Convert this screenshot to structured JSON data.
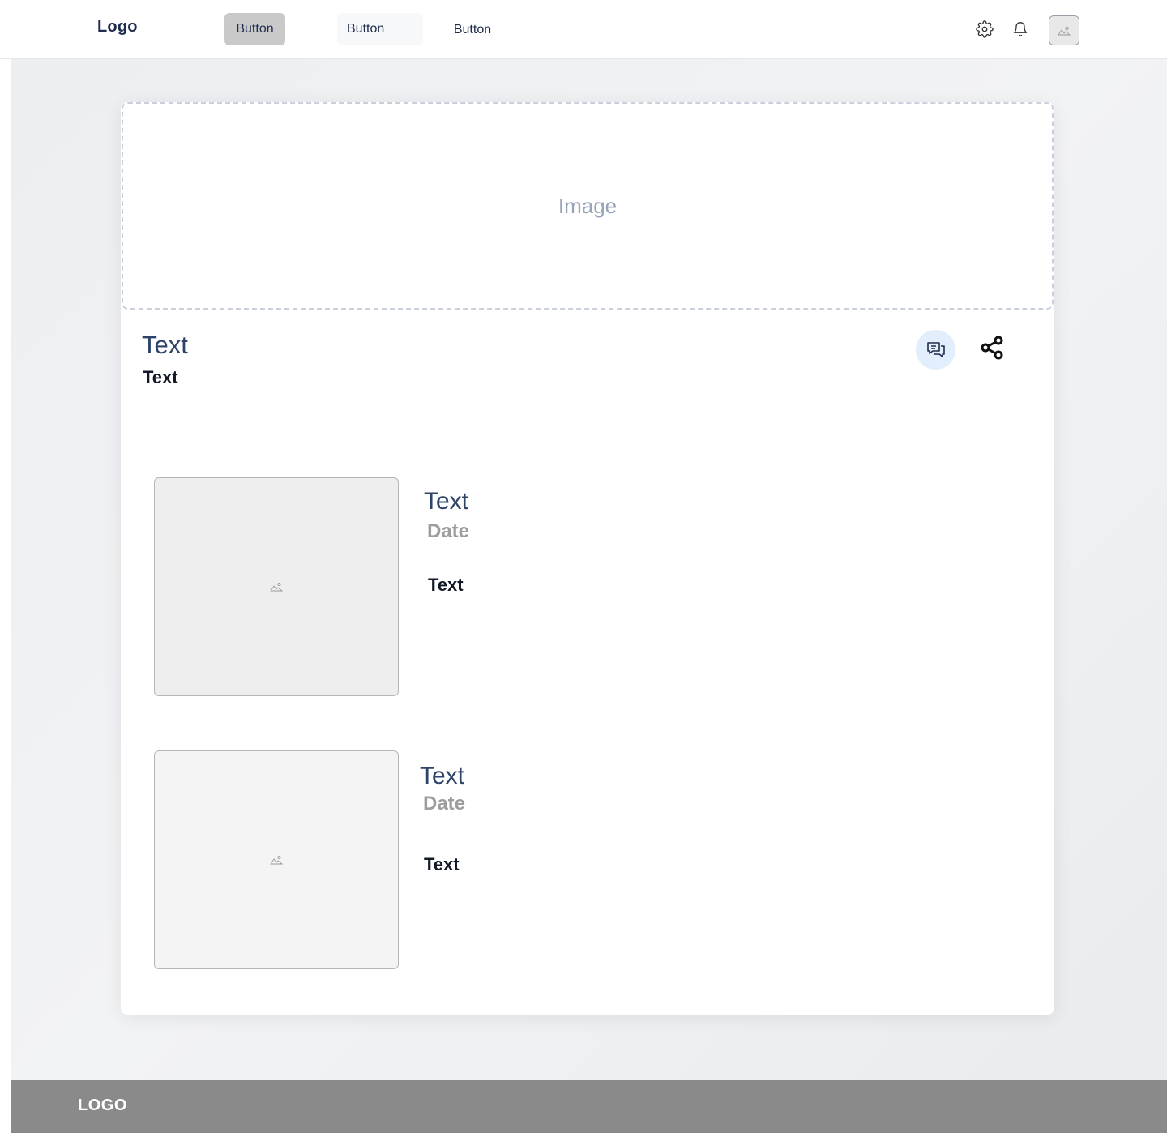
{
  "header": {
    "logo": "Logo",
    "nav": [
      {
        "label": "Button"
      },
      {
        "label": "Button"
      },
      {
        "label": "Button"
      }
    ],
    "icons": [
      "gear-icon",
      "bell-icon"
    ],
    "avatar_icon": "image-placeholder-icon"
  },
  "hero": {
    "label": "Image"
  },
  "post": {
    "title": "Text",
    "subtitle": "Text",
    "actions": [
      "chat-icon",
      "share-icon"
    ]
  },
  "items": [
    {
      "title": "Text",
      "date": "Date",
      "body": "Text",
      "thumb_icon": "image-placeholder-icon"
    },
    {
      "title": "Text",
      "date": "Date",
      "body": "Text",
      "thumb_icon": "image-placeholder-icon"
    }
  ],
  "footer": {
    "logo": "LOGO"
  },
  "colors": {
    "primary_text": "#2d4468",
    "muted": "#9d9d9d",
    "chat_bg": "#e3eefc",
    "footer_bg": "#8a8a8a"
  }
}
